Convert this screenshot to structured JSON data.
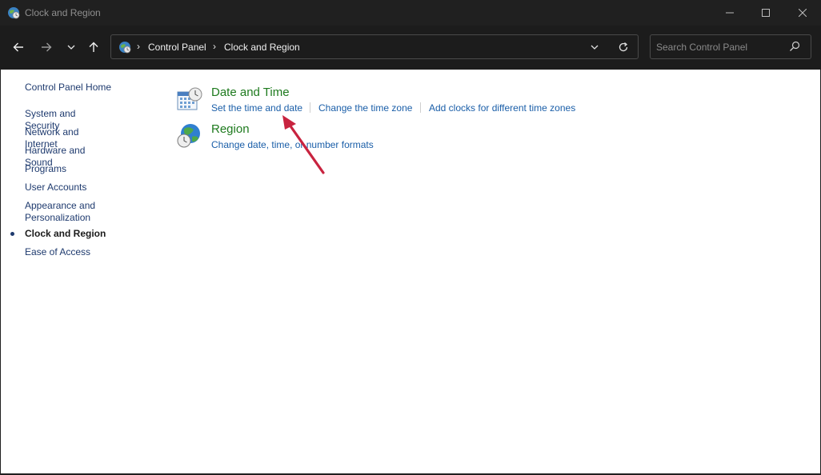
{
  "window": {
    "title": "Clock and Region",
    "controls": [
      "minimize-icon",
      "maximize-icon",
      "close-icon"
    ]
  },
  "navigation": {
    "back_icon": "arrow-left-icon",
    "forward_icon": "arrow-right-icon",
    "recent_icon": "chevron-down-icon",
    "up_icon": "arrow-up-icon",
    "breadcrumb": [
      "Control Panel",
      "Clock and Region"
    ],
    "search_placeholder": "Search Control Panel"
  },
  "sidebar": {
    "home": "Control Panel Home",
    "items": [
      "System and Security",
      "Network and Internet",
      "Hardware and Sound",
      "Programs",
      "User Accounts",
      "Appearance and Personalization",
      "Clock and Region",
      "Ease of Access"
    ],
    "active_item": "Clock and Region"
  },
  "categories": [
    {
      "title": "Date and Time",
      "icon": "calendar-clock-icon",
      "links": [
        "Set the time and date",
        "Change the time zone",
        "Add clocks for different time zones"
      ]
    },
    {
      "title": "Region",
      "icon": "globe-clock-icon",
      "links": [
        "Change date, time, or number formats"
      ]
    }
  ],
  "colors": {
    "titlebar": "#202020",
    "category_title": "#1e7a1e",
    "task_link": "#1a5ea8",
    "sidebar_link": "#1e3a6e",
    "annotation_arrow": "#c8233f"
  }
}
